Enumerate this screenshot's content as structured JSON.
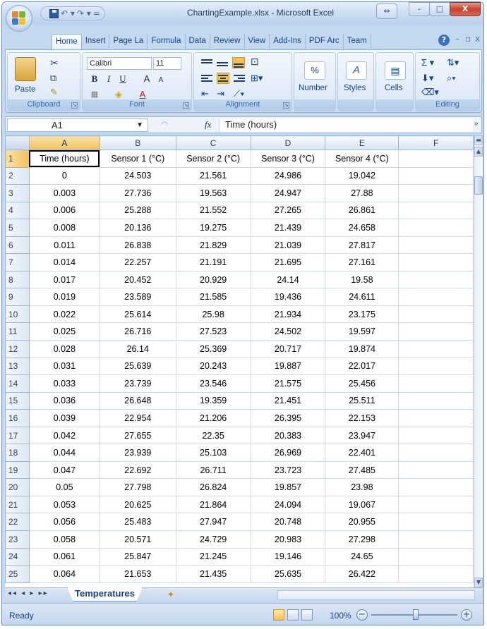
{
  "window": {
    "title": "ChartingExample.xlsx - Microsoft Excel",
    "restore_symbol": "⇔",
    "minimize_symbol": "–",
    "maximize_symbol": "□",
    "close_symbol": "X"
  },
  "qat": {
    "undo_symbol": "↶ ▾",
    "redo_symbol": "↷ ▾",
    "customize_symbol": "="
  },
  "ribbon_tabs": [
    "Home",
    "Insert",
    "Page La",
    "Formula",
    "Data",
    "Review",
    "View",
    "Add-Ins",
    "PDF Arc",
    "Team"
  ],
  "ribbon": {
    "clipboard": {
      "label": "Clipboard",
      "paste_label": "Paste"
    },
    "font": {
      "label": "Font",
      "font_name": "Calibri",
      "font_size": "11",
      "bold": "B",
      "italic": "I",
      "underline": "U",
      "grow": "A",
      "shrink": "A"
    },
    "alignment": {
      "label": "Alignment"
    },
    "number": {
      "label": "Number",
      "percent": "%"
    },
    "styles": {
      "label": "Styles"
    },
    "cells": {
      "label": "Cells"
    },
    "editing": {
      "label": "Editing",
      "sum": "Σ ▾",
      "sort": "⇅▾",
      "find": "⌕▾"
    }
  },
  "formula_bar": {
    "name_box": "A1",
    "fx": "fx",
    "value": "Time (hours)"
  },
  "columns": [
    "A",
    "B",
    "C",
    "D",
    "E",
    "F"
  ],
  "headers": [
    "Time (hours)",
    "Sensor 1 (°C)",
    "Sensor 2 (°C)",
    "Sensor 3 (°C)",
    "Sensor 4 (°C)",
    ""
  ],
  "rows": [
    [
      "0",
      "24.503",
      "21.561",
      "24.986",
      "19.042"
    ],
    [
      "0.003",
      "27.736",
      "19.563",
      "24.947",
      "27.88"
    ],
    [
      "0.006",
      "25.288",
      "21.552",
      "27.265",
      "26.861"
    ],
    [
      "0.008",
      "20.136",
      "19.275",
      "21.439",
      "24.658"
    ],
    [
      "0.011",
      "26.838",
      "21.829",
      "21.039",
      "27.817"
    ],
    [
      "0.014",
      "22.257",
      "21.191",
      "21.695",
      "27.161"
    ],
    [
      "0.017",
      "20.452",
      "20.929",
      "24.14",
      "19.58"
    ],
    [
      "0.019",
      "23.589",
      "21.585",
      "19.436",
      "24.611"
    ],
    [
      "0.022",
      "25.614",
      "25.98",
      "21.934",
      "23.175"
    ],
    [
      "0.025",
      "26.716",
      "27.523",
      "24.502",
      "19.597"
    ],
    [
      "0.028",
      "26.14",
      "25.369",
      "20.717",
      "19.874"
    ],
    [
      "0.031",
      "25.639",
      "20.243",
      "19.887",
      "22.017"
    ],
    [
      "0.033",
      "23.739",
      "23.546",
      "21.575",
      "25.456"
    ],
    [
      "0.036",
      "26.648",
      "19.359",
      "21.451",
      "25.511"
    ],
    [
      "0.039",
      "22.954",
      "21.206",
      "26.395",
      "22.153"
    ],
    [
      "0.042",
      "27.655",
      "22.35",
      "20.383",
      "23.947"
    ],
    [
      "0.044",
      "23.939",
      "25.103",
      "26.969",
      "22.401"
    ],
    [
      "0.047",
      "22.692",
      "26.711",
      "23.723",
      "27.485"
    ],
    [
      "0.05",
      "27.798",
      "26.824",
      "19.857",
      "23.98"
    ],
    [
      "0.053",
      "20.625",
      "21.864",
      "24.094",
      "19.067"
    ],
    [
      "0.056",
      "25.483",
      "27.947",
      "20.748",
      "20.955"
    ],
    [
      "0.058",
      "20.571",
      "24.729",
      "20.983",
      "27.298"
    ],
    [
      "0.061",
      "25.847",
      "21.245",
      "19.146",
      "24.65"
    ],
    [
      "0.064",
      "21.653",
      "21.435",
      "25.635",
      "26.422"
    ]
  ],
  "sheet_tabs": {
    "active": "Temperatures",
    "nav": "◂◂ ◂ ▸ ▸▸"
  },
  "status": {
    "mode": "Ready",
    "zoom": "100%",
    "zoom_out": "−",
    "zoom_in": "+"
  },
  "colors": {
    "accent": "#15428b",
    "selected_header": "#f1c15b",
    "ribbon_bg": "#dfeaf7"
  }
}
